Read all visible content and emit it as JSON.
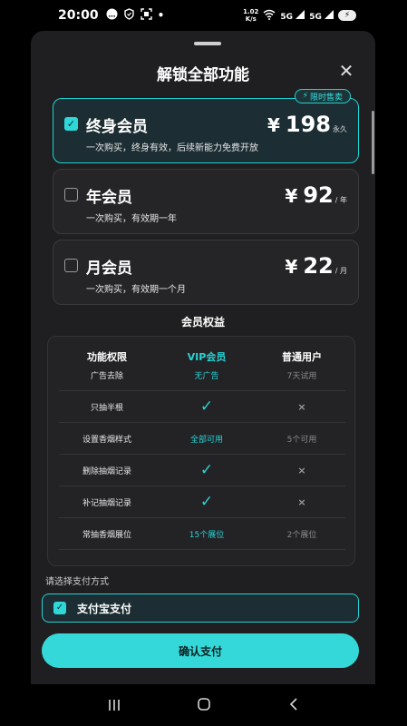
{
  "status_bar": {
    "time": "20:00",
    "net_speed_value": "1.02",
    "net_speed_unit": "K/s",
    "signal1": "5G",
    "signal2": "5G",
    "battery_icon": "battery-charging-icon"
  },
  "sheet": {
    "title": "解锁全部功能",
    "close_icon": "close-icon"
  },
  "plans": [
    {
      "name": "终身会员",
      "desc": "一次购买，终身有效，后续新能力免费开放",
      "currency": "¥",
      "price": "198",
      "unit": "永久",
      "selected": true,
      "badge": "限时售卖"
    },
    {
      "name": "年会员",
      "desc": "一次购买，有效期一年",
      "currency": "¥",
      "price": "92",
      "unit": "/ 年",
      "selected": false
    },
    {
      "name": "月会员",
      "desc": "一次购买，有效期一个月",
      "currency": "¥",
      "price": "22",
      "unit": "/ 月",
      "selected": false
    }
  ],
  "benefits": {
    "title": "会员权益",
    "headers": [
      "功能权限",
      "VIP会员",
      "普通用户"
    ],
    "rows": [
      {
        "feature": "广告去除",
        "vip": "无广告",
        "normal": "7天试用"
      },
      {
        "feature": "只抽半根",
        "vip": "✓",
        "normal": "×"
      },
      {
        "feature": "设置香烟样式",
        "vip": "全部可用",
        "normal": "5个可用"
      },
      {
        "feature": "删除抽烟记录",
        "vip": "✓",
        "normal": "×"
      },
      {
        "feature": "补记抽烟记录",
        "vip": "✓",
        "normal": "×"
      },
      {
        "feature": "常抽香烟展位",
        "vip": "15个展位",
        "normal": "2个展位"
      }
    ]
  },
  "payment": {
    "label": "请选择支付方式",
    "option": "支付宝支付",
    "confirm": "确认支付"
  },
  "nav": {
    "recent": "|||",
    "home": "○",
    "back": "<"
  }
}
